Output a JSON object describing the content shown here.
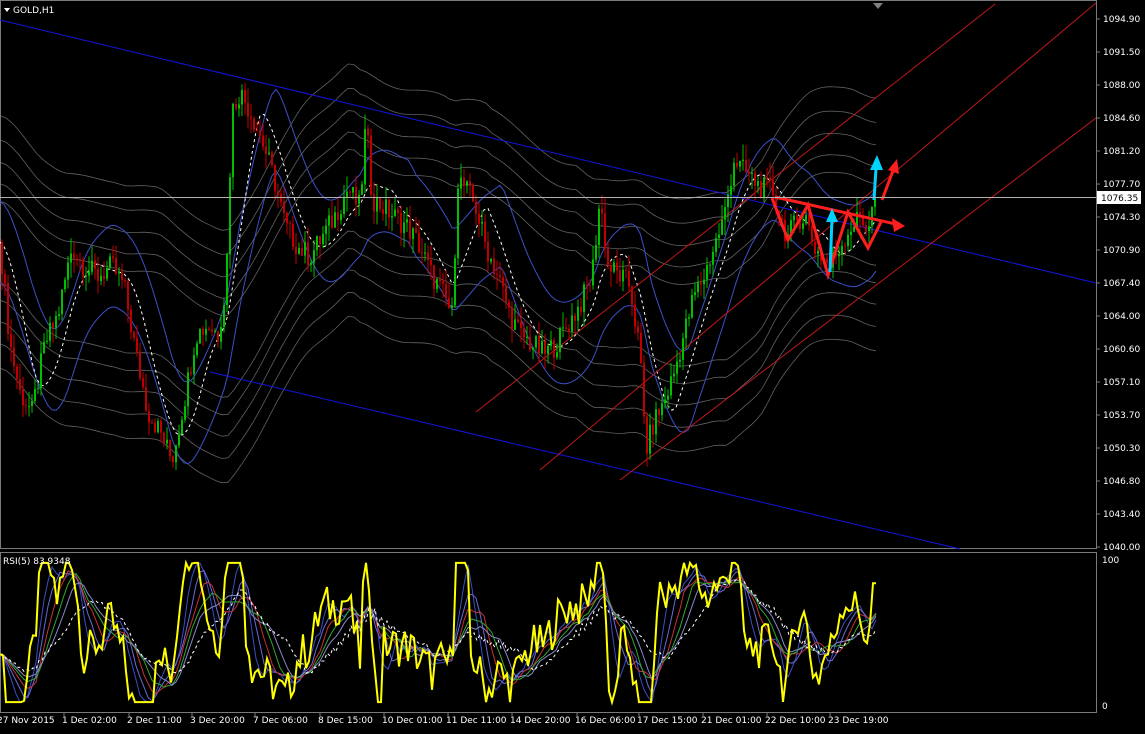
{
  "window": {
    "symbol_title": "GOLD,H1"
  },
  "price_axis": {
    "ticks": [
      "1094.90",
      "1091.50",
      "1088.00",
      "1084.60",
      "1081.20",
      "1077.70",
      "1074.30",
      "1070.90",
      "1067.40",
      "1064.00",
      "1060.60",
      "1057.10",
      "1053.70",
      "1050.30",
      "1046.80",
      "1043.40",
      "1040.00"
    ],
    "range": [
      1040.0,
      1096.0
    ],
    "current_price": "1076.35"
  },
  "time_axis": {
    "labels": [
      "27 Nov 2015",
      "1 Dec 02:00",
      "2 Dec 11:00",
      "3 Dec 20:00",
      "7 Dec 06:00",
      "8 Dec 15:00",
      "10 Dec 01:00",
      "11 Dec 11:00",
      "14 Dec 20:00",
      "16 Dec 06:00",
      "17 Dec 15:00",
      "21 Dec 01:00",
      "22 Dec 10:00",
      "23 Dec 19:00"
    ]
  },
  "indicator": {
    "label": "RSI(5) 83.9348",
    "scale_top": "100",
    "scale_bottom": "0",
    "rsi_value": 83.9348
  },
  "colors": {
    "background": "#000000",
    "grid_text": "#ffffff",
    "bull_candle": "#00c000",
    "bear_candle": "#c00000",
    "channel_blue": "#1414e0",
    "pitchfork_red": "#c01818",
    "bands_blue": "#3c50c8",
    "envelope_gray": "#8a8a8a",
    "pattern_red": "#ff1e1e",
    "arrow_cyan": "#00d2ff",
    "rsi_yellow": "#ffff00"
  },
  "chart_data": {
    "type": "candlestick",
    "title": "GOLD,H1",
    "ylim": [
      1040.0,
      1096.0
    ],
    "close_path": [
      [
        0,
        1071.5
      ],
      [
        10,
        1061.0
      ],
      [
        20,
        1056.0
      ],
      [
        32,
        1054.0
      ],
      [
        45,
        1061.0
      ],
      [
        58,
        1064.0
      ],
      [
        72,
        1071.0
      ],
      [
        84,
        1069.0
      ],
      [
        98,
        1068.0
      ],
      [
        112,
        1069.0
      ],
      [
        124,
        1067.0
      ],
      [
        136,
        1060.0
      ],
      [
        148,
        1054.0
      ],
      [
        160,
        1052.0
      ],
      [
        172,
        1049.0
      ],
      [
        184,
        1055.0
      ],
      [
        196,
        1062.0
      ],
      [
        208,
        1063.0
      ],
      [
        218,
        1062.0
      ],
      [
        226,
        1067.0
      ],
      [
        232,
        1085.0
      ],
      [
        240,
        1087.0
      ],
      [
        250,
        1085.0
      ],
      [
        262,
        1082.0
      ],
      [
        274,
        1078.0
      ],
      [
        286,
        1073.0
      ],
      [
        298,
        1071.0
      ],
      [
        310,
        1070.0
      ],
      [
        322,
        1072.0
      ],
      [
        334,
        1074.0
      ],
      [
        348,
        1077.0
      ],
      [
        360,
        1075.0
      ],
      [
        366,
        1084.0
      ],
      [
        372,
        1076.0
      ],
      [
        384,
        1075.0
      ],
      [
        396,
        1074.0
      ],
      [
        408,
        1073.0
      ],
      [
        420,
        1071.0
      ],
      [
        432,
        1068.0
      ],
      [
        444,
        1066.0
      ],
      [
        452,
        1064.0
      ],
      [
        458,
        1078.0
      ],
      [
        466,
        1077.0
      ],
      [
        476,
        1075.0
      ],
      [
        486,
        1071.0
      ],
      [
        498,
        1068.0
      ],
      [
        510,
        1064.0
      ],
      [
        520,
        1062.0
      ],
      [
        532,
        1061.0
      ],
      [
        544,
        1060.0
      ],
      [
        556,
        1061.0
      ],
      [
        568,
        1063.0
      ],
      [
        580,
        1065.0
      ],
      [
        592,
        1068.0
      ],
      [
        600,
        1076.0
      ],
      [
        608,
        1069.0
      ],
      [
        620,
        1068.0
      ],
      [
        630,
        1067.0
      ],
      [
        640,
        1060.0
      ],
      [
        646,
        1050.0
      ],
      [
        654,
        1053.0
      ],
      [
        664,
        1055.0
      ],
      [
        674,
        1058.0
      ],
      [
        684,
        1062.0
      ],
      [
        694,
        1066.0
      ],
      [
        704,
        1068.0
      ],
      [
        714,
        1071.0
      ],
      [
        724,
        1074.0
      ],
      [
        734,
        1080.0
      ],
      [
        742,
        1079.0
      ],
      [
        752,
        1078.0
      ],
      [
        762,
        1077.0
      ],
      [
        772,
        1077.0
      ],
      [
        780,
        1074.0
      ],
      [
        788,
        1072.0
      ],
      [
        798,
        1074.0
      ],
      [
        806,
        1074.0
      ],
      [
        814,
        1071.0
      ],
      [
        822,
        1070.0
      ],
      [
        830,
        1069.0
      ],
      [
        840,
        1071.0
      ],
      [
        850,
        1073.0
      ],
      [
        860,
        1074.0
      ],
      [
        868,
        1073.0
      ],
      [
        876,
        1076.35
      ]
    ]
  }
}
